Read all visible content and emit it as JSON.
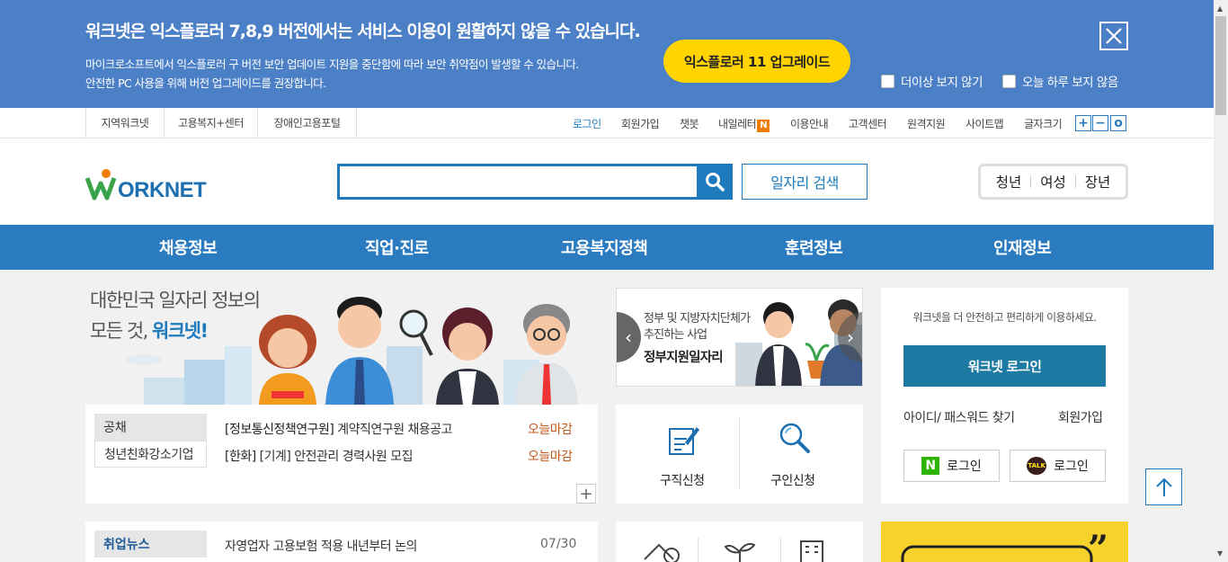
{
  "banner": {
    "title": "워크넷은 익스플로러 7,8,9 버전에서는 서비스 이용이 원활하지 않을 수 있습니다.",
    "desc1": "마이크로소프트에서 익스플로러 구 버전 보안 업데이트 지원을 중단함에 따라 보안 취약점이 발생할 수 있습니다.",
    "desc2": "안전한 PC 사용을 위해 버전 업그레이드를 권장합니다.",
    "upgrade_label": "익스플로러 11 업그레이드",
    "never_show": "더이상 보지 않기",
    "today_hide": "오늘 하루 보지 않음"
  },
  "util": {
    "left_links": [
      "지역워크넷",
      "고용복지+센터",
      "장애인고용포털"
    ],
    "login": "로그인",
    "signup": "회원가입",
    "chatbot": "챗봇",
    "newsletter": "내일레터",
    "newsletter_badge": "N",
    "guide": "이용안내",
    "support": "고객센터",
    "remote": "원격지원",
    "sitemap": "사이트맵",
    "fontsize": "글자크기",
    "font_plus": "+",
    "font_minus": "−",
    "font_reset": "o"
  },
  "header": {
    "logo_text": "WORKNET",
    "search_placeholder": "",
    "job_search": "일자리 검색",
    "age_youth": "청년",
    "age_women": "여성",
    "age_senior": "장년"
  },
  "gnb": [
    "채용정보",
    "직업·진로",
    "고용복지정책",
    "훈련정보",
    "인재정보"
  ],
  "hero": {
    "line1": "대한민국 일자리 정보의",
    "line2_prefix": "모든 것, ",
    "line2_brand": "워크넷!"
  },
  "notice": {
    "tab1": "공채",
    "tab2": "청년친화강소기업",
    "rows": [
      {
        "company": "[정보통신정책연구원]",
        "title": "계약직연구원 채용공고",
        "due": "오늘마감"
      },
      {
        "company": "[한화]",
        "title": "[기계] 안전관리 경력사원 모집",
        "due": "오늘마감"
      }
    ],
    "more": "+"
  },
  "news": {
    "tab": "취업뉴스",
    "title": "자영업자 고용보험 적용 내년부터 논의",
    "date": "07/30"
  },
  "gov": {
    "line1": "정부 및 지방자치단체가",
    "line2": "추진하는 사업",
    "title": "정부지원일자리",
    "prev": "‹",
    "next": "›"
  },
  "quick": {
    "apply_job": "구직신청",
    "apply_hire": "구인신청"
  },
  "login": {
    "message": "워크넷을 더 안전하고 편리하게 이용하세요.",
    "button": "워크넷 로그인",
    "find": "아이디/ 패스워드 찾기",
    "join": "회원가입",
    "naver": "로그인",
    "naver_mark": "N",
    "kakao": "로그인",
    "kakao_mark": "TALK"
  },
  "colors": {
    "banner_bg": "#4b7fc6",
    "upgrade_btn": "#ffd400",
    "brand_blue": "#2a7bbf",
    "login_btn": "#1d7aa3",
    "due_color": "#c65a1c"
  }
}
